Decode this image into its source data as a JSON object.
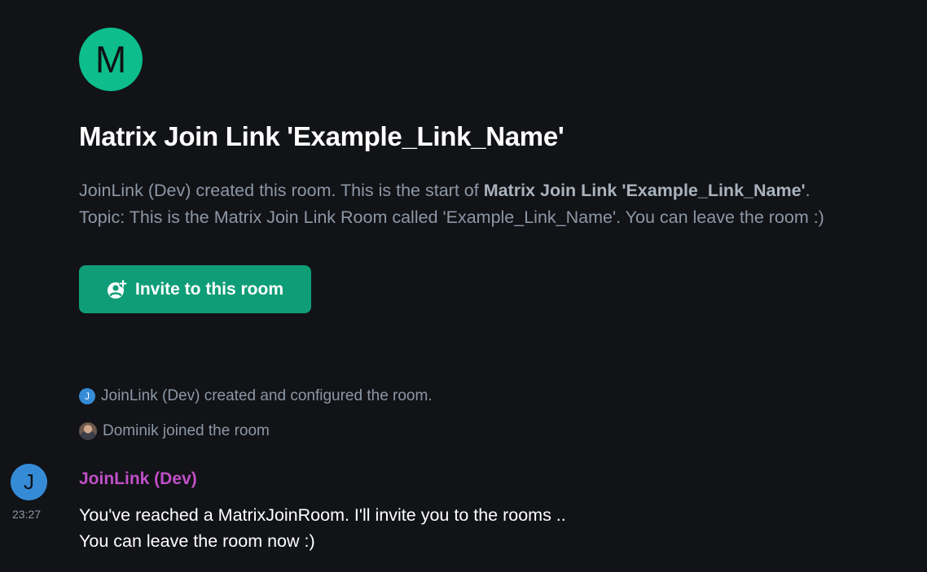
{
  "room": {
    "avatar_letter": "M",
    "title": "Matrix Join Link 'Example_Link_Name'",
    "intro": {
      "creator_prefix": "JoinLink (Dev) created this room. This is the start of ",
      "room_name_bold": "Matrix Join Link 'Example_Link_Name'",
      "period": ".",
      "topic": "Topic: This is the Matrix Join Link Room called 'Example_Link_Name'. You can leave the room :)"
    },
    "invite_button_label": "Invite to this room",
    "invite_icon": "add-user-icon"
  },
  "events": [
    {
      "avatar_letter": "J",
      "text": "JoinLink (Dev) created and configured the room."
    },
    {
      "avatar": "user-photo-avatar",
      "text": "Dominik joined the room"
    }
  ],
  "message": {
    "sender_avatar_letter": "J",
    "sender": "JoinLink (Dev)",
    "timestamp": "23:27",
    "lines": [
      "You've reached a MatrixJoinRoom. I'll invite you to the rooms ..",
      "You can leave the room now :)"
    ]
  },
  "colors": {
    "background": "#111317",
    "accent": "#0dbd8b",
    "button": "#0f9d78",
    "sender_name": "#c04fc7",
    "muted_text": "#8d97a5",
    "user_avatar": "#368bd6"
  }
}
